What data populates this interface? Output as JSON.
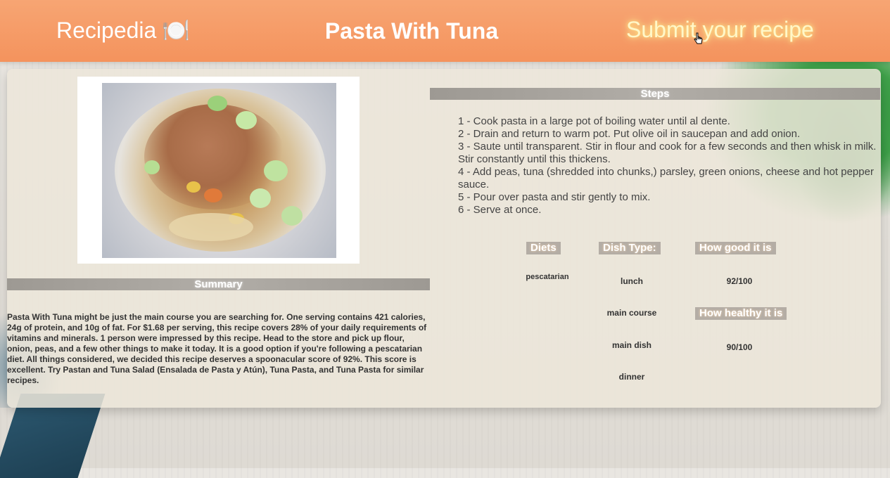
{
  "nav": {
    "brand": "Recipedia",
    "brand_icon": "🍽️",
    "title": "Pasta With Tuna",
    "submit_label": "Submit your recipe"
  },
  "colors": {
    "navbar": "#f4935d",
    "section_bar": "#a8a49e",
    "submit_glow": "#ffe97a"
  },
  "image": {
    "alt": "pasta-with-tuna-photo"
  },
  "steps": {
    "heading": "Steps",
    "items": [
      "1 - Cook pasta in a large pot of boiling water until al dente.",
      "2 - Drain and return to warm pot. Put olive oil in saucepan and add onion.",
      "3 - Saute until transparent. Stir in flour and cook for a few seconds and then whisk in milk. Stir constantly until this thickens.",
      "4 - Add peas, tuna (shredded into chunks,) parsley, green onions, cheese and hot pepper sauce.",
      "5 - Pour over pasta and stir gently to mix.",
      "6 - Serve at once."
    ]
  },
  "summary": {
    "heading": "Summary",
    "text": "Pasta With Tuna might be just the main course you are searching for. One serving contains 421 calories, 24g of protein, and 10g of fat. For $1.68 per serving, this recipe covers 28% of your daily requirements of vitamins and minerals. 1 person were impressed by this recipe. Head to the store and pick up flour, onion, peas, and a few other things to make it today. It is a good option if you're following a pescatarian diet. All things considered, we decided this recipe deserves a spoonacular score of 92%. This score is excellent. Try Pastan and Tuna Salad (Ensalada de Pasta y Atún), Tuna Pasta, and Tuna Pasta for similar recipes."
  },
  "info": {
    "diets_label": "Diets",
    "diets": [
      "pescatarian"
    ],
    "dish_type_label": "Dish Type:",
    "dish_types": [
      "lunch",
      "main course",
      "main dish",
      "dinner"
    ],
    "how_good_label": "How good it is",
    "how_good_value": "92/100",
    "how_healthy_label": "How healthy it is",
    "how_healthy_value": "90/100"
  }
}
